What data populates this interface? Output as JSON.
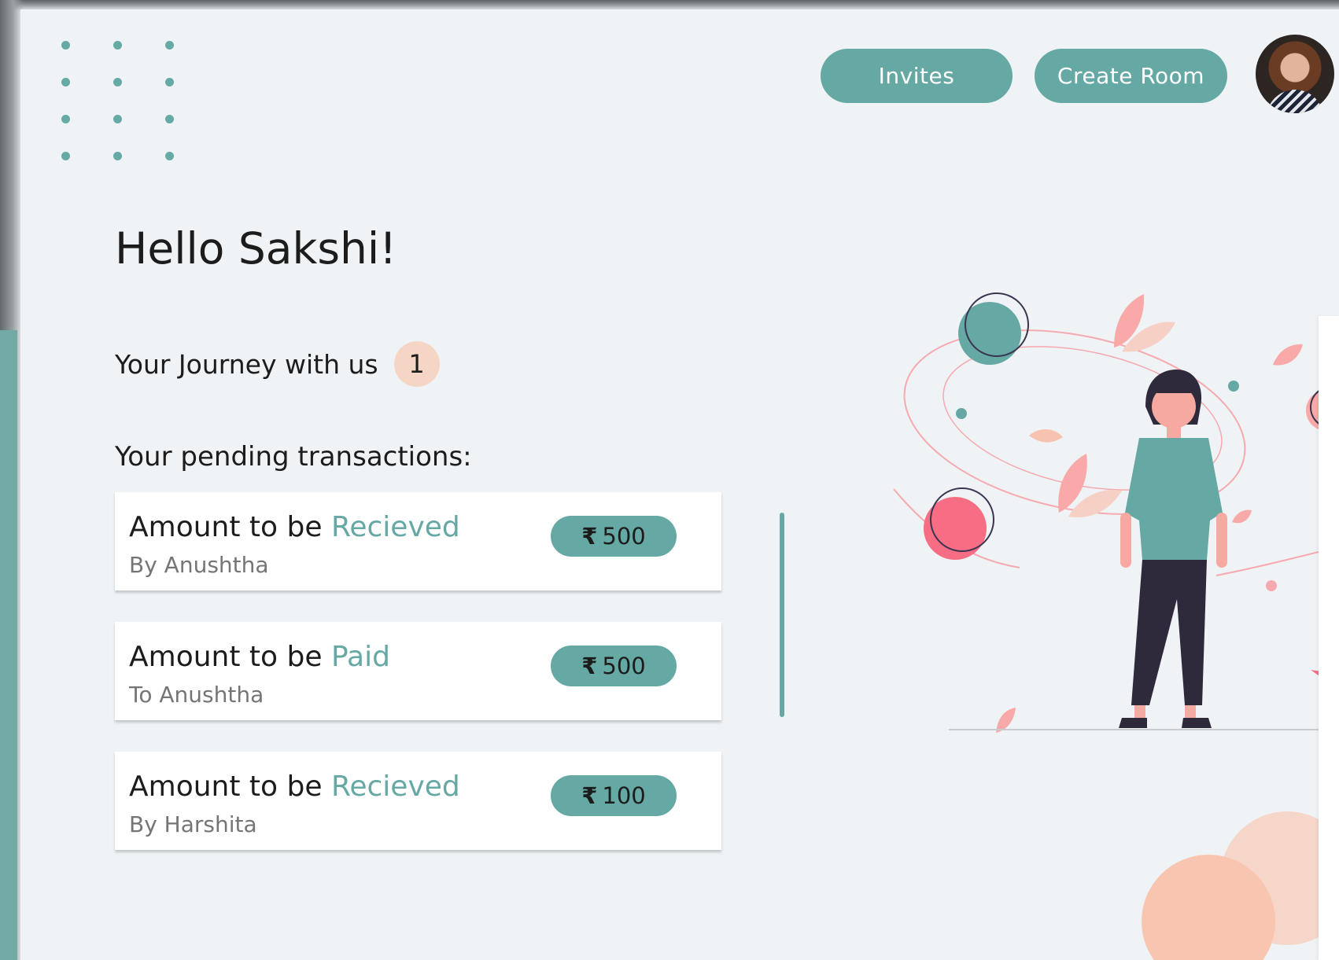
{
  "header": {
    "invites_label": "Invites",
    "create_room_label": "Create Room"
  },
  "greeting": "Hello Sakshi!",
  "journey": {
    "label": "Your Journey with us",
    "count": "1"
  },
  "pending_title": "Your pending transactions:",
  "transactions": [
    {
      "title_prefix": "Amount to be",
      "title_type": "Recieved",
      "subtitle": "By Anushtha",
      "currency": "₹",
      "amount": "500"
    },
    {
      "title_prefix": "Amount to be",
      "title_type": "Paid",
      "subtitle": "To Anushtha",
      "currency": "₹",
      "amount": "500"
    },
    {
      "title_prefix": "Amount to be",
      "title_type": "Recieved",
      "subtitle": "By Harshita",
      "currency": "₹",
      "amount": "100"
    }
  ],
  "colors": {
    "accent": "#66a9a4",
    "background": "#eff3f5",
    "badge": "#f5d5c4",
    "illustration_pink": "#f76d84",
    "illustration_peach": "#f8c6b0"
  },
  "icons": [
    "dots-pattern-icon",
    "avatar-photo",
    "person-illustration"
  ]
}
